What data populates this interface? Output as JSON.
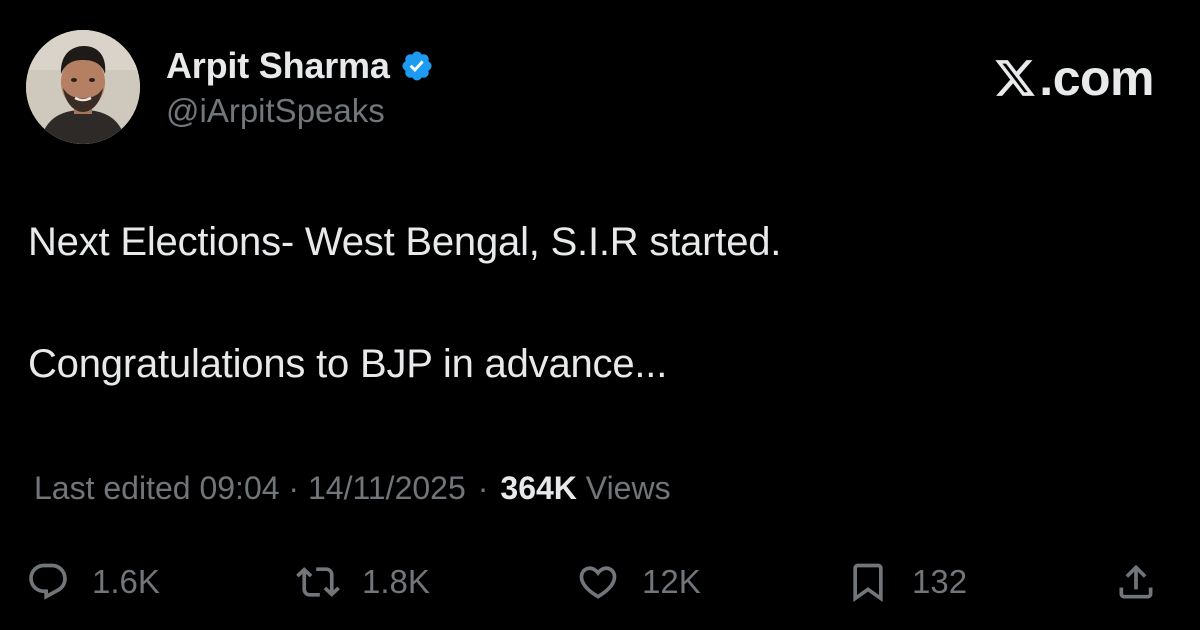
{
  "author": {
    "name": "Arpit Sharma",
    "handle": "@iArpitSpeaks",
    "verified": true
  },
  "brand": {
    "text": ".com"
  },
  "post": {
    "line1": "Next Elections- West Bengal, S.I.R started.",
    "line2": "Congratulations to BJP in advance..."
  },
  "meta": {
    "edited": "Last edited 09:04 · 14/11/2025",
    "separator": "·",
    "views_count": "364K",
    "views_label": "Views"
  },
  "actions": {
    "replies": "1.6K",
    "reposts": "1.8K",
    "likes": "12K",
    "bookmarks": "132"
  },
  "colors": {
    "background": "#000000",
    "primary_text": "#e7e9ea",
    "secondary_text": "#71767b",
    "verified_badge": "#1d9bf0"
  }
}
